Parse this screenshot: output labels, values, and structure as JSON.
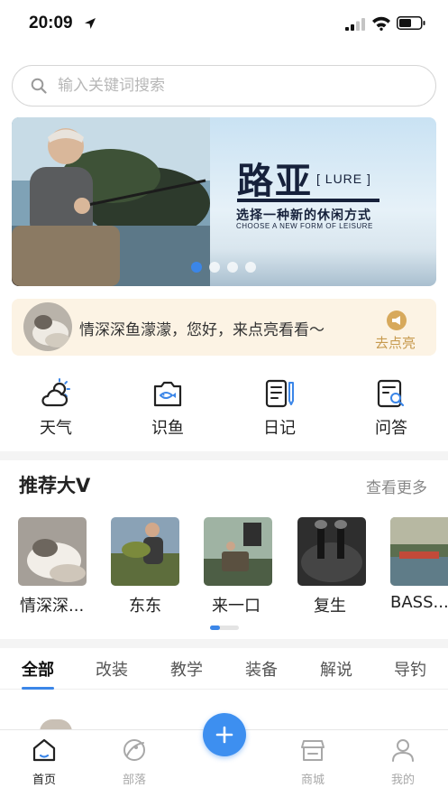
{
  "status_bar": {
    "time": "20:09"
  },
  "search": {
    "placeholder": "输入关键词搜索"
  },
  "banner": {
    "brand": "路亚",
    "tag": "[ LURE ]",
    "subtitle": "选择一种新的休闲方式",
    "subtitle_en": "CHOOSE A NEW FORM OF LEISURE",
    "slide_count": 4,
    "active_slide": 1
  },
  "greeting": {
    "text": "情深深鱼濛濛，您好，来点亮看看～",
    "action_label": "去点亮"
  },
  "quick_menu": [
    {
      "label": "天气",
      "icon": "weather-icon"
    },
    {
      "label": "识鱼",
      "icon": "fish-camera-icon"
    },
    {
      "label": "日记",
      "icon": "diary-icon"
    },
    {
      "label": "问答",
      "icon": "qa-icon"
    }
  ],
  "recommended": {
    "title": "推荐大V",
    "more_label": "查看更多",
    "influencers": [
      {
        "name": "情深深..."
      },
      {
        "name": "东东"
      },
      {
        "name": "来一口"
      },
      {
        "name": "复生"
      },
      {
        "name": "BASS..."
      }
    ]
  },
  "tabs": {
    "items": [
      "全部",
      "改装",
      "教学",
      "装备",
      "解说",
      "导钓"
    ],
    "active": "全部"
  },
  "bottom_nav": {
    "items": [
      {
        "label": "首页",
        "icon": "home-icon",
        "active": true
      },
      {
        "label": "部落",
        "icon": "tribe-icon",
        "active": false
      },
      {
        "label": "商城",
        "icon": "store-icon",
        "active": false
      },
      {
        "label": "我的",
        "icon": "profile-icon",
        "active": false
      }
    ],
    "fab_icon": "plus-icon"
  },
  "colors": {
    "accent": "#3d8ff0",
    "greeting_bg": "#fcf3e4",
    "greeting_action": "#c79a4e",
    "banner_text": "#16213b"
  }
}
